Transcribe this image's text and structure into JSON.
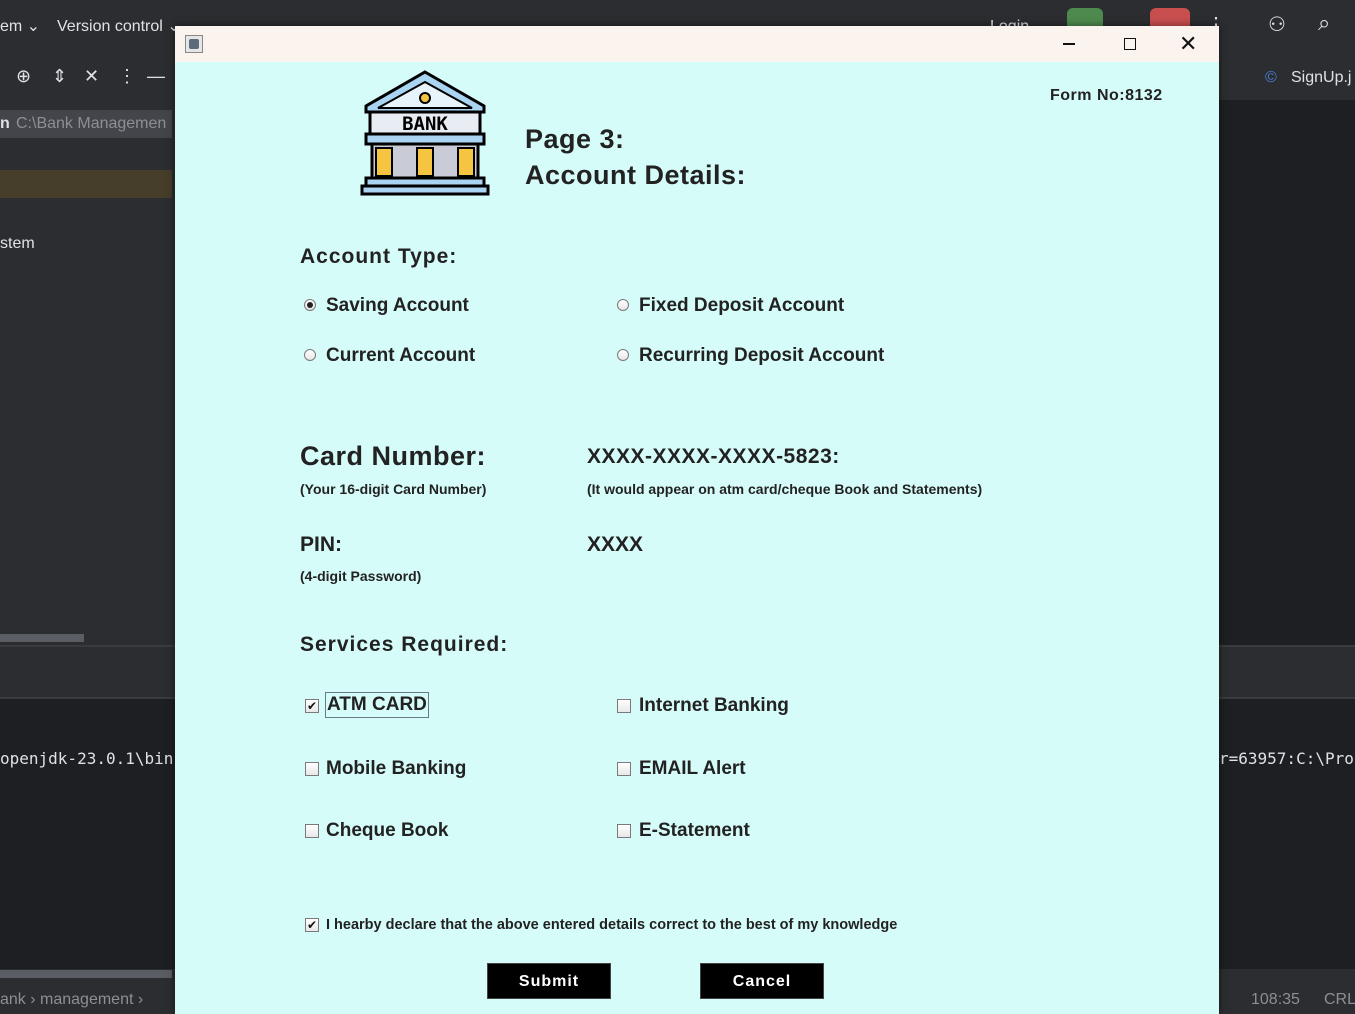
{
  "ide": {
    "menu_project": "em",
    "menu_vcs": "Version control",
    "login": "Login",
    "path": "C:\\Bank Managemen",
    "tree_item_prefix": "n",
    "tree_item": "stem",
    "tab": "SignUp.j",
    "console_left": "openjdk-23.0.1\\bin",
    "console_right": "r=63957:C:\\Pro",
    "breadcrumb": [
      "ank",
      "management"
    ],
    "position": "108:35",
    "encoding": "CRL"
  },
  "form": {
    "form_no": "Form No:8132",
    "logo_text": "BANK",
    "page": "Page 3:",
    "heading": "Account Details:",
    "account_type_label": "Account Type:",
    "account_types": [
      {
        "label": "Saving Account",
        "selected": true
      },
      {
        "label": "Fixed Deposit Account",
        "selected": false
      },
      {
        "label": "Current Account",
        "selected": false
      },
      {
        "label": "Recurring Deposit Account",
        "selected": false
      }
    ],
    "card_label": "Card Number:",
    "card_hint": "(Your 16-digit Card Number)",
    "card_value": "XXXX-XXXX-XXXX-5823:",
    "card_note": "(It would appear on atm card/cheque Book and Statements)",
    "pin_label": "PIN:",
    "pin_hint": "(4-digit Password)",
    "pin_value": "XXXX",
    "services_label": "Services Required:",
    "services": [
      {
        "label": "ATM CARD",
        "checked": true
      },
      {
        "label": "Internet Banking",
        "checked": false
      },
      {
        "label": "Mobile Banking",
        "checked": false
      },
      {
        "label": "EMAIL Alert",
        "checked": false
      },
      {
        "label": "Cheque Book",
        "checked": false
      },
      {
        "label": "E-Statement",
        "checked": false
      }
    ],
    "declaration": "I hearby declare that the above entered details correct to the best of my knowledge",
    "declaration_checked": true,
    "submit": "Submit",
    "cancel": "Cancel"
  },
  "colors": {
    "dialog_bg": "#d6fcfa",
    "titlebar_bg": "#fbf3ee",
    "button_bg": "#000000"
  }
}
